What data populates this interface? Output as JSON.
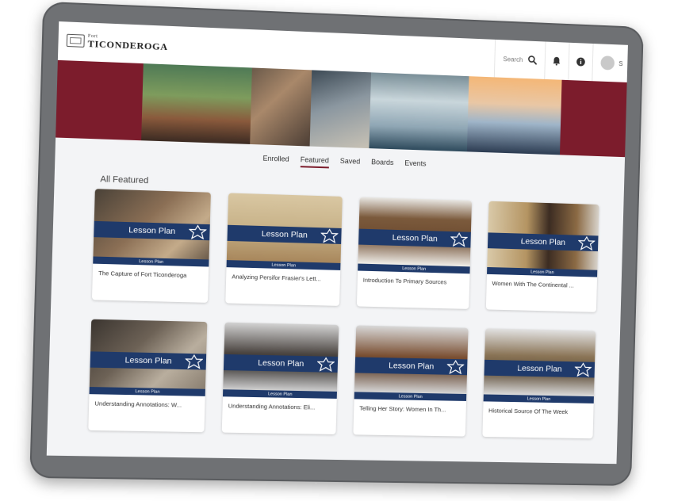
{
  "header": {
    "logo_small": "Fort",
    "logo_big": "TICONDEROGA",
    "search_label": "Search",
    "user_initial": "S"
  },
  "nav": {
    "tabs": [
      {
        "label": "Enrolled",
        "active": false
      },
      {
        "label": "Featured",
        "active": true
      },
      {
        "label": "Saved",
        "active": false
      },
      {
        "label": "Boards",
        "active": false
      },
      {
        "label": "Events",
        "active": false
      }
    ]
  },
  "main": {
    "section_title": "All Featured",
    "cards": [
      {
        "badge": "Lesson Plan",
        "type": "Lesson Plan",
        "title": "The Capture of Fort Ticonderoga"
      },
      {
        "badge": "Lesson Plan",
        "type": "Lesson Plan",
        "title": "Analyzing Persifor Frasier's Lett..."
      },
      {
        "badge": "Lesson Plan",
        "type": "Lesson Plan",
        "title": "Introduction To Primary Sources"
      },
      {
        "badge": "Lesson Plan",
        "type": "Lesson Plan",
        "title": "Women With The Continental ..."
      },
      {
        "badge": "Lesson Plan",
        "type": "Lesson Plan",
        "title": "Understanding Annotations: W..."
      },
      {
        "badge": "Lesson Plan",
        "type": "Lesson Plan",
        "title": "Understanding Annotations: Eli..."
      },
      {
        "badge": "Lesson Plan",
        "type": "Lesson Plan",
        "title": "Telling Her Story: Women In Th..."
      },
      {
        "badge": "Lesson Plan",
        "type": "Lesson Plan",
        "title": "Historical Source Of The Week"
      }
    ]
  },
  "colors": {
    "banner": "#7c1c2c",
    "ribbon": "#1f3a6b"
  },
  "icons": [
    "search-icon",
    "bell-icon",
    "info-icon",
    "avatar",
    "fort-star-icon"
  ]
}
